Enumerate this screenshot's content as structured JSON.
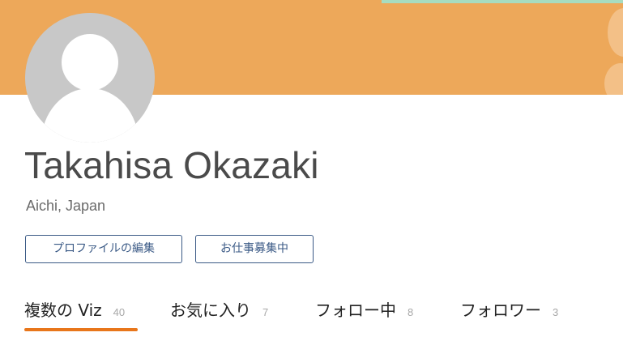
{
  "profile": {
    "name": "Takahisa Okazaki",
    "location": "Aichi, Japan"
  },
  "actions": {
    "edit_profile_label": "プロファイルの編集",
    "hire_label": "お仕事募集中"
  },
  "tabs": [
    {
      "label": "複数の Viz",
      "count": "40",
      "active": true
    },
    {
      "label": "お気に入り",
      "count": "7",
      "active": false
    },
    {
      "label": "フォロー中",
      "count": "8",
      "active": false
    },
    {
      "label": "フォロワー",
      "count": "3",
      "active": false
    }
  ],
  "colors": {
    "banner": "#eda85a",
    "banner_accent": "#a7dcc0",
    "button_border": "#3b5a86",
    "active_tab_underline": "#e8761b",
    "avatar_background": "#c8c8c8"
  },
  "icons": {
    "avatar": "default-user-avatar-icon"
  }
}
